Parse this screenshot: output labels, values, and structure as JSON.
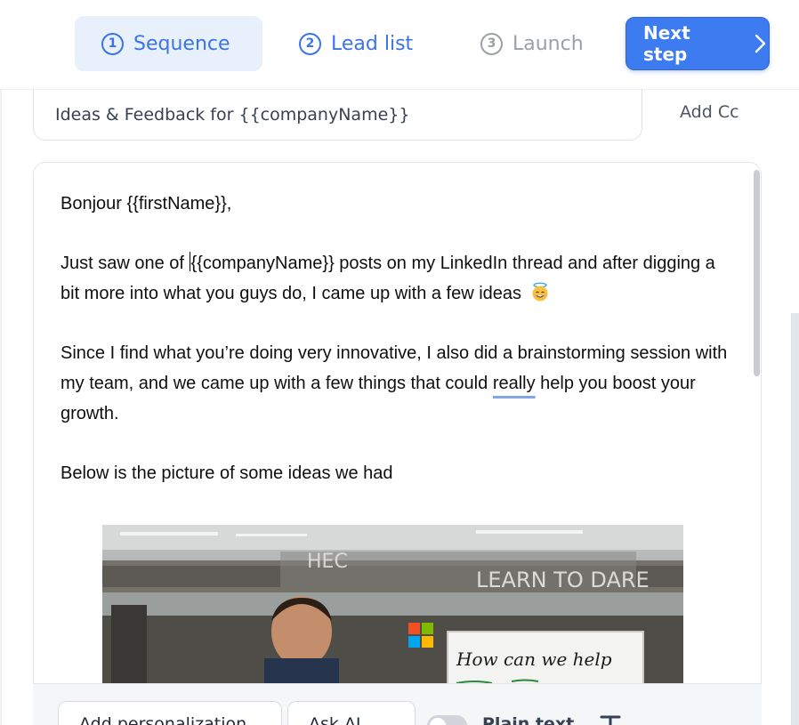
{
  "steps": [
    {
      "number": "1",
      "label": "Sequence",
      "state": "active"
    },
    {
      "number": "2",
      "label": "Lead list",
      "state": "enabled"
    },
    {
      "number": "3",
      "label": "Launch",
      "state": "disabled"
    }
  ],
  "next_button": {
    "label": "Next step",
    "icon": "chevron-right-icon"
  },
  "subject": {
    "value": "Ideas & Feedback for {{companyName}}",
    "add_cc_label": "Add Cc"
  },
  "email_body": {
    "greeting": "Bonjour {{firstName}},",
    "paragraph_1_start": "Just saw one of ",
    "paragraph_1_rest": "{{companyName}} posts on my LinkedIn thread and after digging a bit more into what you guys do, I came up with a few ideas",
    "paragraph_1_emoji": "smiling-face-with-halo-emoji",
    "paragraph_2_before": "Since I find what you’re doing very innovative, I also did a brainstorming session with my team, and we came up with a few things that could ",
    "paragraph_2_flagged": "really",
    "paragraph_2_after": " help you boost your growth.",
    "paragraph_3": "Below is the picture of some ideas we had",
    "image": {
      "description_icon": "embedded-photo",
      "sign_text_1": "HEC",
      "sign_text_2": "LEARN TO DARE",
      "whiteboard_text": "How can we help"
    }
  },
  "toolbar": {
    "personalization_label": "Add personalization",
    "ask_ai_label": "Ask AI",
    "plain_text_label": "Plain text",
    "plain_text_enabled": false,
    "text_format_icon": "text-format-icon"
  },
  "colors": {
    "accent": "#3c7bf0",
    "accent_light": "#e8f0fc",
    "disabled": "#9aa0a8"
  }
}
